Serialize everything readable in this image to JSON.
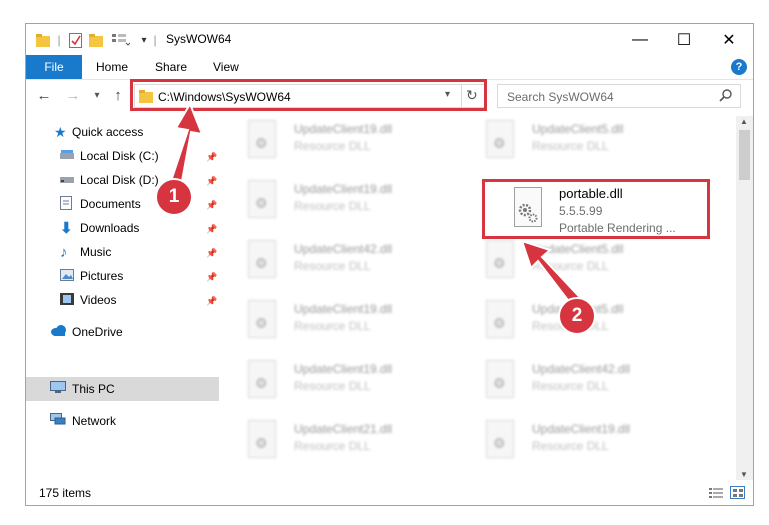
{
  "window": {
    "title": "SysWOW64",
    "controls": {
      "minimize": "—",
      "maximize": "☐",
      "close": "✕"
    }
  },
  "ribbon": {
    "tabs": [
      "File",
      "Home",
      "Share",
      "View"
    ],
    "help": "?"
  },
  "address_bar": {
    "path": "C:\\Windows\\SysWOW64",
    "search_placeholder": "Search SysWOW64"
  },
  "sidebar": {
    "quick_access": "Quick access",
    "items": [
      {
        "label": "Local Disk (C:)",
        "icon": "drive-icon",
        "pinned": true
      },
      {
        "label": "Local Disk (D:)",
        "icon": "drive-icon",
        "pinned": true
      },
      {
        "label": "Documents",
        "icon": "documents-icon",
        "pinned": true
      },
      {
        "label": "Downloads",
        "icon": "downloads-icon",
        "pinned": true
      },
      {
        "label": "Music",
        "icon": "music-icon",
        "pinned": true
      },
      {
        "label": "Pictures",
        "icon": "pictures-icon",
        "pinned": true
      },
      {
        "label": "Videos",
        "icon": "videos-icon",
        "pinned": true
      }
    ],
    "onedrive": "OneDrive",
    "this_pc": "This PC",
    "network": "Network"
  },
  "files": [
    {
      "name": "UpdateClient19.dll",
      "desc": "Resource DLL"
    },
    {
      "name": "UpdateClient5.dll",
      "desc": "Resource DLL"
    },
    {
      "name": "UpdateClient19.dll",
      "desc": "Resource DLL"
    },
    {
      "name": "UpdateClient42.dll",
      "desc": "Resource DLL"
    },
    {
      "name": "UpdateClient5.dll",
      "desc": "Resource DLL"
    },
    {
      "name": "UpdateClient19.dll",
      "desc": "Resource DLL"
    },
    {
      "name": "UpdateClient5.dll",
      "desc": "Resource DLL"
    },
    {
      "name": "UpdateClient19.dll",
      "desc": "Resource DLL"
    },
    {
      "name": "UpdateClient42.dll",
      "desc": "Resource DLL"
    },
    {
      "name": "UpdateClient21.dll",
      "desc": "Resource DLL"
    },
    {
      "name": "UpdateClient19.dll",
      "desc": "Resource DLL"
    }
  ],
  "selected_file": {
    "name": "portable.dll",
    "version": "5.5.5.99",
    "desc": "Portable Rendering ..."
  },
  "status": {
    "items": "175 items"
  },
  "annotations": {
    "step1": "1",
    "step2": "2",
    "color": "#d6343f"
  }
}
